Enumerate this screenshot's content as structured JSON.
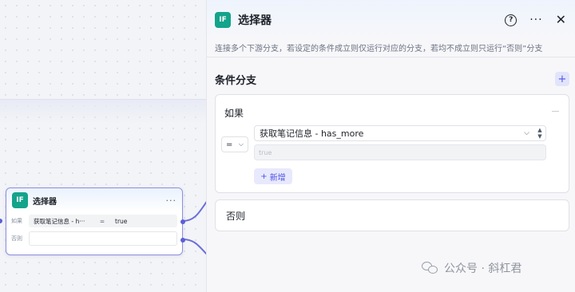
{
  "node": {
    "icon_text": "IF",
    "title": "选择器",
    "more": "···",
    "if_label": "如果",
    "else_label": "否则",
    "condition_left": "获取笔记信息 - h···",
    "condition_op": "=",
    "condition_right": "true"
  },
  "panel": {
    "icon_text": "IF",
    "title": "选择器",
    "help": "?",
    "more": "···",
    "close": "✕",
    "description": "连接多个下游分支，若设定的条件成立则仅运行对应的分支，若均不成立则只运行“否则”分支",
    "section_title": "条件分支",
    "add": "+",
    "if_branch": {
      "label": "如果",
      "operator": "=",
      "variable": "获取笔记信息 - has_more",
      "value_placeholder": "true",
      "add_condition": "新增",
      "add_condition_icon": "+"
    },
    "else_branch": {
      "label": "否则"
    }
  },
  "watermark": {
    "text": "公众号 · 斜杠君"
  },
  "colors": {
    "accent": "#4d53e8",
    "node_icon": "#14a38b",
    "node_border": "#8e8fe0"
  }
}
